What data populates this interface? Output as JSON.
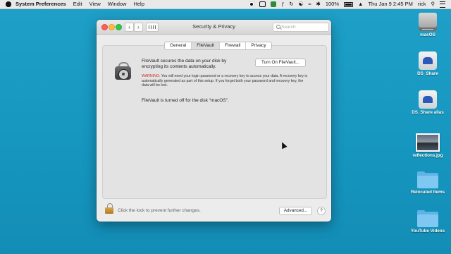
{
  "menubar": {
    "app_name": "System Preferences",
    "menus": [
      "Edit",
      "View",
      "Window",
      "Help"
    ],
    "battery_text": "100%",
    "clock": "Thu Jan 9  2:45 PM",
    "user": "rick"
  },
  "window": {
    "title": "Security & Privacy",
    "search_placeholder": "Search",
    "tabs": [
      {
        "label": "General",
        "active": false
      },
      {
        "label": "FileVault",
        "active": true
      },
      {
        "label": "Firewall",
        "active": false
      },
      {
        "label": "Privacy",
        "active": false
      }
    ],
    "filevault": {
      "description": "FileVault secures the data on your disk by encrypting its contents automatically.",
      "turn_on_button": "Turn On FileVault...",
      "warning_label": "WARNING:",
      "warning_text": "You will need your login password or a recovery key to access your data. A recovery key is automatically generated as part of this setup. If you forget both your password and recovery key, the data will be lost.",
      "status": "FileVault is turned off for the disk “macOS”."
    },
    "lock_text": "Click the lock to prevent further changes.",
    "advanced_button": "Advanced...",
    "help_button": "?"
  },
  "desktop": {
    "icons": [
      {
        "label": "macOS",
        "icon": "hard-drive-icon"
      },
      {
        "label": "DS_Share",
        "icon": "network-share-icon"
      },
      {
        "label": "DS_Share alias",
        "icon": "network-share-icon"
      },
      {
        "label": "reflections.jpg",
        "icon": "image-file-icon"
      },
      {
        "label": "Relocated Items",
        "icon": "folder-icon"
      },
      {
        "label": "YouTube Videos",
        "icon": "folder-icon"
      }
    ]
  }
}
